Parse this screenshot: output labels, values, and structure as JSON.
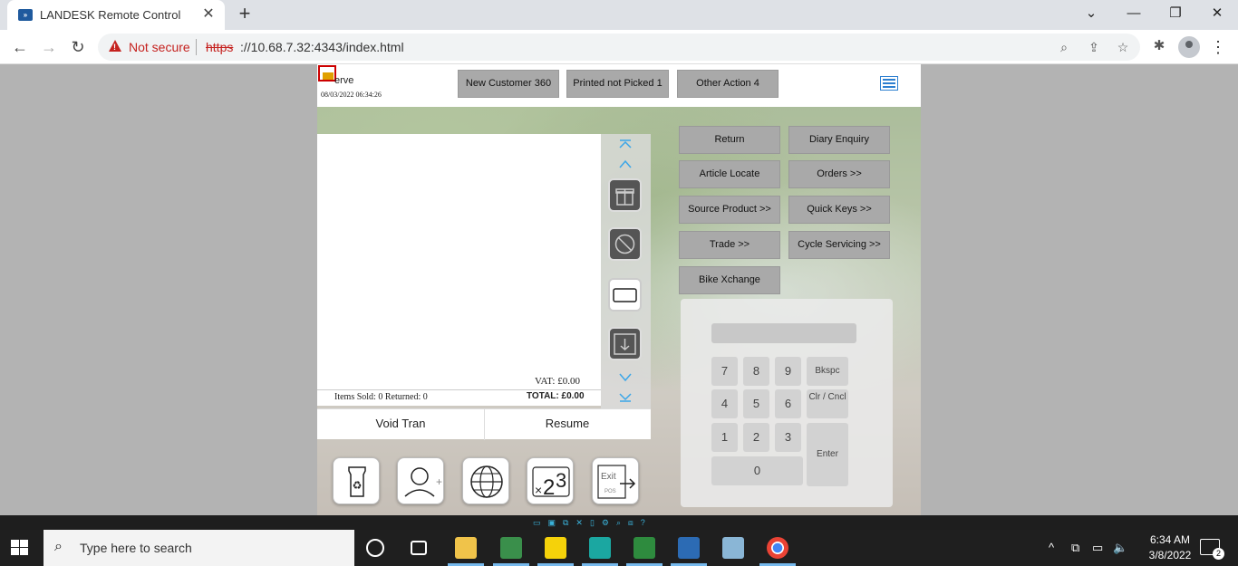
{
  "browser": {
    "tab_title": "LANDESK Remote Control",
    "tab_favicon": "landesk-icon",
    "not_secure": "Not secure",
    "url_protocol": "https",
    "url_rest": "://10.68.7.32:4343/index.html"
  },
  "pos": {
    "app_name": "erve",
    "datetime": "08/03/2022 06:34:26",
    "header_buttons": [
      "New Customer 360",
      "Printed not Picked 1",
      "Other Action 4"
    ],
    "vat": "VAT:  £0.00",
    "items_sold": "Items Sold: 0   Returned: 0",
    "total": "TOTAL: £0.00",
    "void_tran": "Void Tran",
    "resume": "Resume",
    "function_buttons": [
      "Return",
      "Diary Enquiry",
      "Article Locate",
      "Orders >>",
      "Source Product >>",
      "Quick Keys >>",
      "Trade >>",
      "Cycle Servicing >>",
      "Bike Xchange"
    ],
    "keypad": {
      "k7": "7",
      "k8": "8",
      "k9": "9",
      "bksp": "Bkspc",
      "k4": "4",
      "k5": "5",
      "k6": "6",
      "clr": "Clr / Cncl",
      "k1": "1",
      "k2": "2",
      "k3": "3",
      "enter": "Enter",
      "k0": "0"
    }
  },
  "taskbar": {
    "search_placeholder": "Type here to search",
    "time": "6:34 AM",
    "date": "3/8/2022",
    "notifications": "2"
  },
  "colors": {
    "pos_button": "#a9a9a9",
    "accent_blue": "#2d7fd0",
    "warning_red": "#c5221f"
  }
}
